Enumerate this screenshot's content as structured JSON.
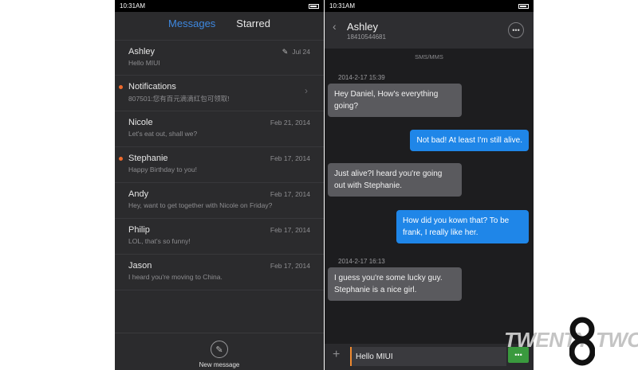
{
  "left": {
    "status_time": "10:31AM",
    "tabs": [
      {
        "label": "Messages",
        "active": true
      },
      {
        "label": "Starred",
        "active": false
      }
    ],
    "conversations": [
      {
        "name": "Ashley",
        "preview": "Hello MIUI",
        "date": "Jul 24",
        "unread": false,
        "icon": "pencil-icon"
      },
      {
        "name": "Notifications",
        "preview": "807501:您有百元滴滴红包可领取!",
        "date": "",
        "unread": true,
        "icon": "chevron-right-icon"
      },
      {
        "name": "Nicole",
        "preview": "Let's eat out, shall we?",
        "date": "Feb 21, 2014",
        "unread": false
      },
      {
        "name": "Stephanie",
        "preview": "Happy Birthday to you!",
        "date": "Feb 17, 2014",
        "unread": true
      },
      {
        "name": "Andy",
        "preview": "Hey, want to get together with Nicole on Friday?",
        "date": "Feb 17, 2014",
        "unread": false
      },
      {
        "name": "Philip",
        "preview": "LOL, that's so funny!",
        "date": "Feb 17, 2014",
        "unread": false
      },
      {
        "name": "Jason",
        "preview": "I heard you're moving to China.",
        "date": "Feb 17, 2014",
        "unread": false
      }
    ],
    "new_message_label": "New message",
    "accent_color": "#3e88e0",
    "unread_dot_color": "#ef6a2c"
  },
  "right": {
    "status_time": "10:31AM",
    "contact_name": "Ashley",
    "contact_phone": "18410544681",
    "channel": "SMS/MMS",
    "messages": [
      {
        "type": "timestamp",
        "text": "2014-2-17 15:39"
      },
      {
        "type": "in",
        "lines": [
          "Hey Daniel, How's everything",
          "going?"
        ]
      },
      {
        "type": "out",
        "lines": [
          "Not bad! At least I'm still alive."
        ]
      },
      {
        "type": "in",
        "lines": [
          "Just  alive?I heard you're going",
          "out with Stephanie."
        ]
      },
      {
        "type": "out",
        "lines": [
          "How did you kown that? To be",
          "frank, I really like her."
        ]
      },
      {
        "type": "timestamp",
        "text": "2014-2-17 16:13"
      },
      {
        "type": "in",
        "lines": [
          "I guess you're some lucky guy.",
          "Stephanie is a nice girl."
        ]
      }
    ],
    "input_value": "Hello MIUI",
    "send_label": "•••",
    "bubble_out_color": "#1f86e8",
    "send_color": "#3a9a3e"
  },
  "logo": {
    "word1": "TWENTY",
    "word2": "TWO"
  }
}
